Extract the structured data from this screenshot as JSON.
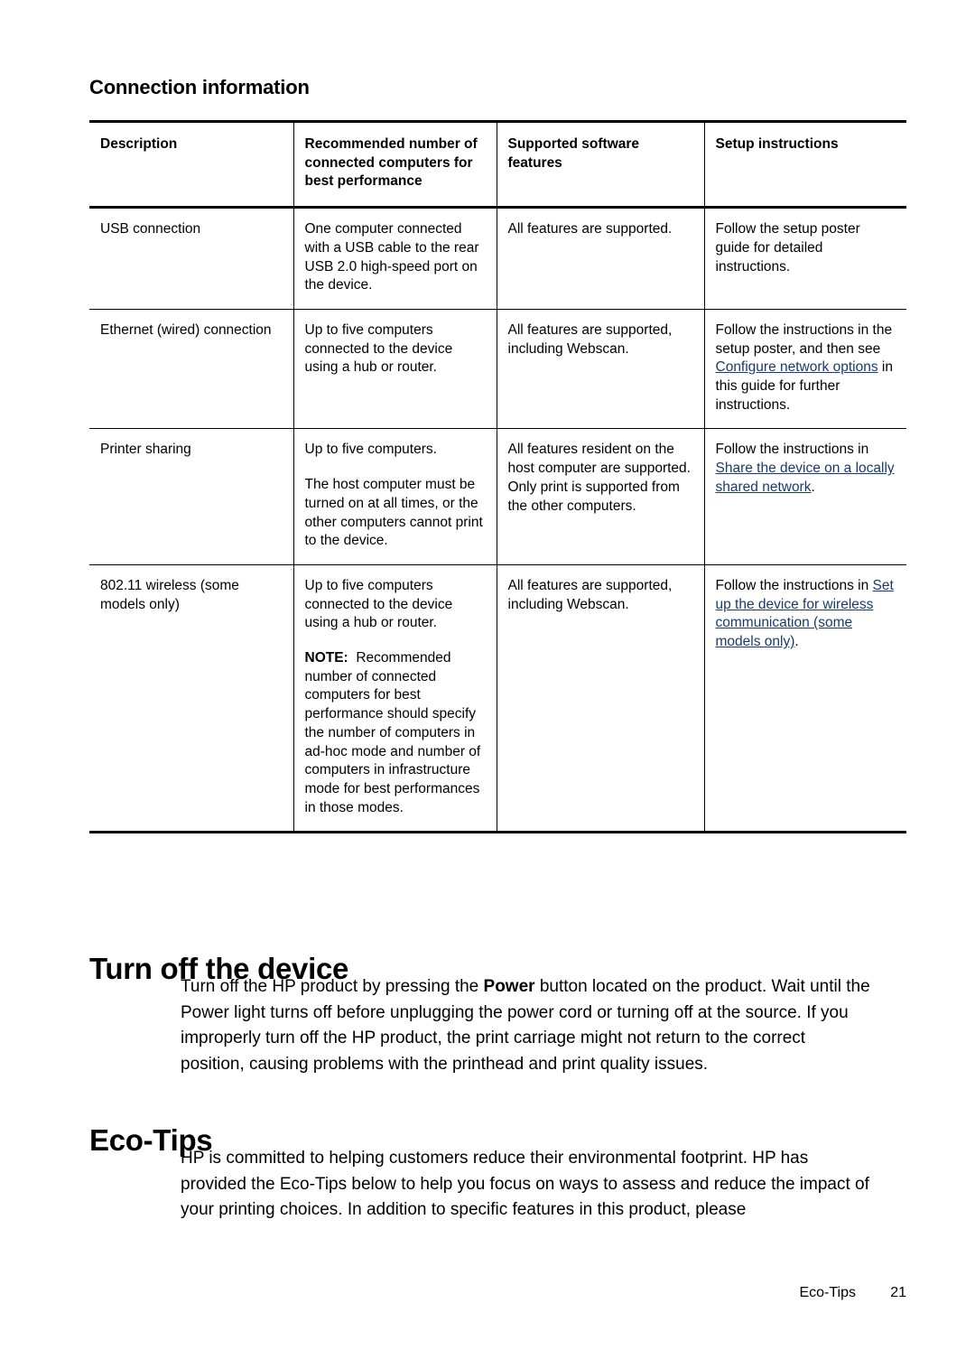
{
  "document": {
    "section_heading": "Connection information",
    "footer": {
      "label": "Eco-Tips",
      "page_number": "21"
    },
    "link_color": "#1a3a6e"
  },
  "table": {
    "headers": [
      "Description",
      "Recommended number of connected computers for best performance",
      "Supported software features",
      "Setup instructions"
    ],
    "rows": [
      {
        "description": "USB connection",
        "recommended": "One computer connected with a USB cable to the rear USB 2.0 high-speed port on the device.",
        "features": "All features are supported.",
        "setup_before": "Follow the setup poster guide for detailed instructions.",
        "setup_link": "",
        "setup_after": ""
      },
      {
        "description": "Ethernet (wired) connection",
        "recommended": "Up to five computers connected to the device using a hub or router.",
        "features": "All features are supported, including Webscan.",
        "setup_before": "Follow the instructions in the setup poster, and then see ",
        "setup_link": "Configure network options",
        "setup_after": " in this guide for further instructions."
      },
      {
        "description": "Printer sharing",
        "recommended": "Up to five computers.",
        "recommended_2": "The host computer must be turned on at all times, or the other computers cannot print to the device.",
        "features": "All features resident on the host computer are supported. Only print is supported from the other computers.",
        "setup_before": "Follow the instructions in ",
        "setup_link": "Share the device on a locally shared network",
        "setup_after": "."
      },
      {
        "description": "802.11 wireless (some models only)",
        "recommended": "Up to five computers connected to the device using a hub or router.",
        "recommended_note_label": "NOTE:",
        "recommended_note_text": "Recommended number of connected computers for best performance should specify the number of computers in ad-hoc mode and number of computers in infrastructure mode for best performances in those modes.",
        "features": "All features are supported, including Webscan.",
        "setup_before": "Follow the instructions in ",
        "setup_link": "Set up the device for wireless communication (some models only)",
        "setup_after": "."
      }
    ]
  },
  "sections": [
    {
      "heading": "Turn off the device",
      "body_pre_bold": "Turn off the HP product by pressing the ",
      "body_bold": "Power",
      "body_post_bold": " button located on the product. Wait until the Power light turns off before unplugging the power cord or turning off at the source. If you improperly turn off the HP product, the print carriage might not return to the correct position, causing problems with the printhead and print quality issues."
    },
    {
      "heading": "Eco-Tips",
      "body": "HP is committed to helping customers reduce their environmental footprint. HP has provided the Eco-Tips below to help you focus on ways to assess and reduce the impact of your printing choices. In addition to specific features in this product, please"
    }
  ]
}
